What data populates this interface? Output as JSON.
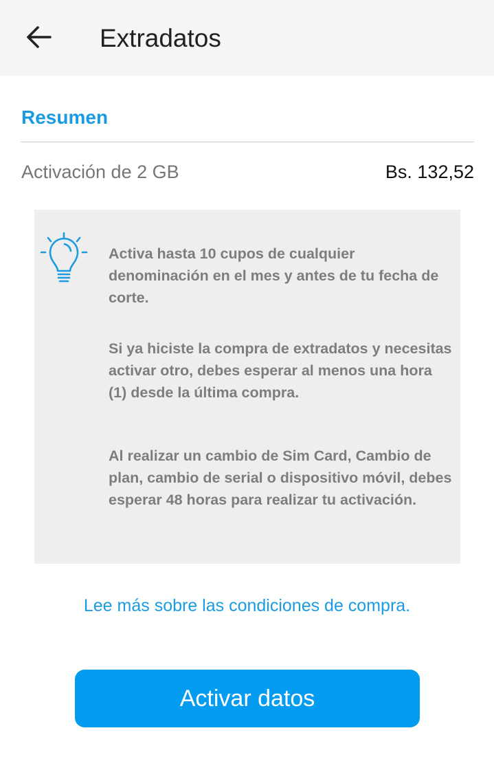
{
  "app_bar": {
    "title": "Extradatos",
    "back_icon": "arrow-left-icon"
  },
  "summary": {
    "section_title": "Resumen",
    "item_label": "Activación de 2 GB",
    "item_price": "Bs. 132,52"
  },
  "info_box": {
    "icon": "lightbulb-icon",
    "paragraphs": [
      "Activa hasta 10 cupos de cualquier denominación en el mes y antes de tu fecha de corte.",
      "Si ya hiciste la compra de extradatos y necesitas activar otro, debes esperar al menos una hora (1) desde la última compra.",
      "Al realizar un cambio de Sim Card, Cambio de plan, cambio de serial o dispositivo móvil, debes esperar 48 horas para realizar tu activación."
    ]
  },
  "more_link": "Lee más sobre las condiciones de compra.",
  "primary_button": "Activar datos",
  "colors": {
    "accent": "#1a9be0",
    "button": "#039cf0",
    "app_bar_bg": "#f5f5f5",
    "info_bg": "#eeeeee"
  }
}
